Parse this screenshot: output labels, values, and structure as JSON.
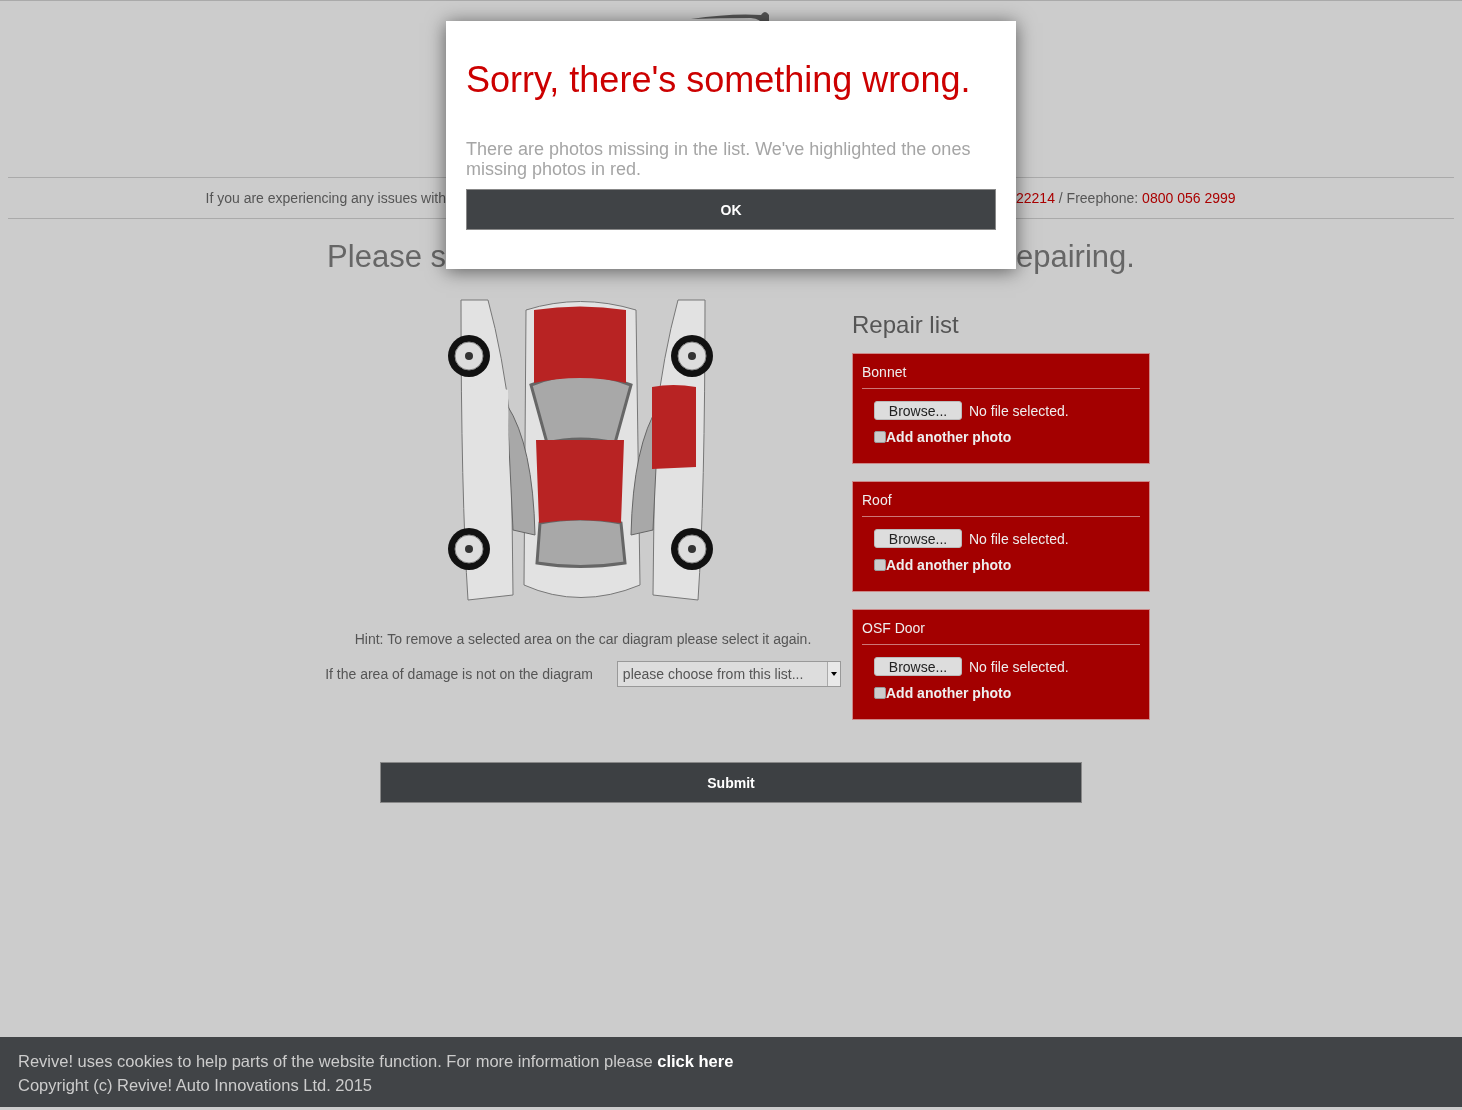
{
  "contact_bar": {
    "left_text": "If you are experiencing any issues with",
    "right_parts": [
      {
        "text": "22214",
        "kind": "link"
      },
      {
        "text": " / Freephone: ",
        "kind": "plain"
      },
      {
        "text": "0800 056 2999",
        "kind": "link"
      }
    ]
  },
  "heading": {
    "left": "Please s",
    "right": "epairing."
  },
  "car_diagram": {
    "areas": [
      {
        "kind": "bonnet",
        "selected": true
      },
      {
        "kind": "roof",
        "selected": true
      },
      {
        "kind": "osf_door",
        "selected": true
      },
      {
        "kind": "nsf_door",
        "selected": false
      }
    ]
  },
  "hint": "Hint: To remove a selected area on the car diagram please select it again.",
  "other_area": {
    "label": "If the area of damage is not on the diagram",
    "value": "please choose from this list..."
  },
  "repair_list": {
    "title": "Repair list",
    "items": [
      {
        "name": "Bonnet",
        "browse_label": "Browse...",
        "file_status": "No file selected.",
        "add_another_label": "Add another photo",
        "add_another_checked": false
      },
      {
        "name": "Roof",
        "browse_label": "Browse...",
        "file_status": "No file selected.",
        "add_another_label": "Add another photo",
        "add_another_checked": false
      },
      {
        "name": "OSF Door",
        "browse_label": "Browse...",
        "file_status": "No file selected.",
        "add_another_label": "Add another photo",
        "add_another_checked": false
      }
    ]
  },
  "submit": "Submit",
  "cookie_bar": {
    "message": "Revive! uses cookies to help parts of the website function. For more information please",
    "link": "click here",
    "copyright": "Copyright (c) Revive! Auto Innovations Ltd. 2015"
  },
  "dialog": {
    "title": "Sorry, there's something wrong.",
    "message": "There are photos missing in the list. We've highlighted the ones missing photos in red.",
    "button": "OK"
  }
}
